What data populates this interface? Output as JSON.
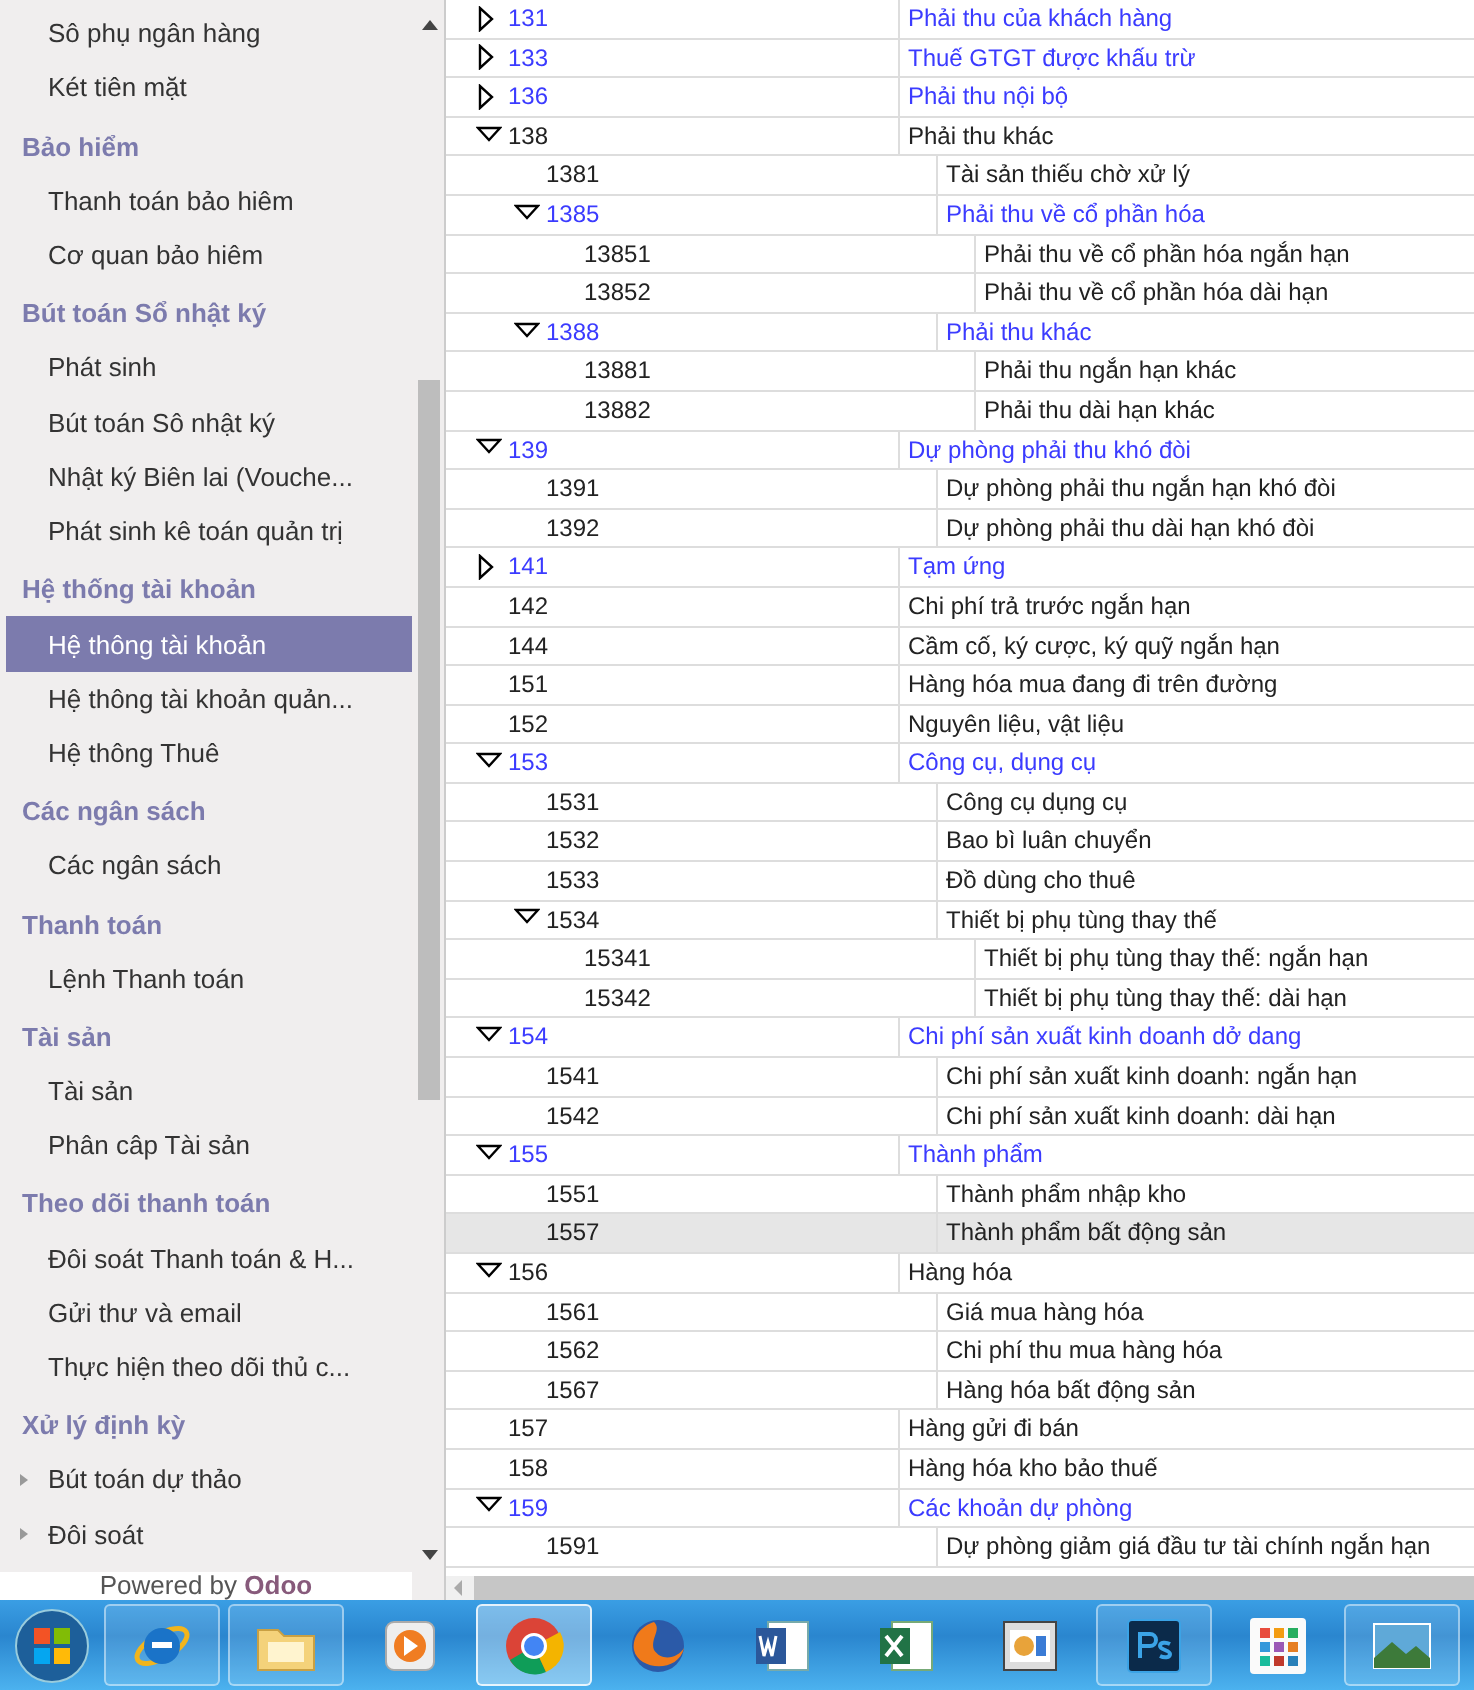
{
  "sidebar": {
    "groups": [
      {
        "items": [
          {
            "label": "Sô phụ ngân hàng",
            "kind": "link",
            "selected": false
          },
          {
            "label": "Két tiên mặt",
            "kind": "link",
            "selected": false
          }
        ]
      },
      {
        "title": "Bảo hiểm",
        "items": [
          {
            "label": "Thanh toán bảo hiêm",
            "kind": "link",
            "selected": false
          },
          {
            "label": "Cơ quan bảo hiêm",
            "kind": "link",
            "selected": false
          }
        ]
      },
      {
        "title": "Bút toán Sổ nhật ký",
        "items": [
          {
            "label": "Phát sinh",
            "kind": "link",
            "selected": false
          },
          {
            "label": "Bút toán Sô nhật ký",
            "kind": "link",
            "selected": false
          },
          {
            "label": "Nhật ký Biên lai (Vouche...",
            "kind": "link",
            "selected": false
          },
          {
            "label": "Phát sinh kê toán quản trị",
            "kind": "link",
            "selected": false
          }
        ]
      },
      {
        "title": "Hệ thống tài khoản",
        "items": [
          {
            "label": "Hệ thông tài khoản",
            "kind": "link",
            "selected": true
          },
          {
            "label": "Hệ thông tài khoản quản...",
            "kind": "link",
            "selected": false
          },
          {
            "label": "Hệ thông Thuê",
            "kind": "link",
            "selected": false
          }
        ]
      },
      {
        "title": "Các ngân sách",
        "items": [
          {
            "label": "Các ngân sách",
            "kind": "link",
            "selected": false
          }
        ]
      },
      {
        "title": "Thanh toán",
        "items": [
          {
            "label": "Lệnh Thanh toán",
            "kind": "link",
            "selected": false
          }
        ]
      },
      {
        "title": "Tài sản",
        "items": [
          {
            "label": "Tài sản",
            "kind": "link",
            "selected": false
          },
          {
            "label": "Phân câp Tài sản",
            "kind": "link",
            "selected": false
          }
        ]
      },
      {
        "title": "Theo dõi thanh toán",
        "items": [
          {
            "label": "Đôi soát Thanh toán & H...",
            "kind": "link",
            "selected": false
          },
          {
            "label": "Gửi thư và email",
            "kind": "link",
            "selected": false
          },
          {
            "label": "Thực hiện theo dõi thủ c...",
            "kind": "link",
            "selected": false
          }
        ]
      },
      {
        "title": "Xử lý định kỳ",
        "items": [
          {
            "label": "Bút toán dự thảo",
            "kind": "folder",
            "selected": false
          },
          {
            "label": "Đôi soát",
            "kind": "folder",
            "selected": false
          }
        ]
      }
    ],
    "footer": {
      "text": "Powered by",
      "brand": "Odoo"
    }
  },
  "tree": {
    "rows": [
      {
        "code": "131",
        "name": "Phải thu của khách hàng",
        "link": true,
        "expanded": false,
        "selected": false
      },
      {
        "code": "133",
        "name": "Thuế GTGT được khấu trừ",
        "link": true,
        "expanded": false,
        "selected": false
      },
      {
        "code": "136",
        "name": "Phải thu nội bộ",
        "link": true,
        "expanded": false,
        "selected": false
      },
      {
        "code": "138",
        "name": "Phải thu khác",
        "link": false,
        "expanded": true,
        "selected": false,
        "children": [
          {
            "code": "1381",
            "name": "Tài sản thiếu chờ xử lý",
            "link": false,
            "selected": false
          },
          {
            "code": "1385",
            "name": "Phải thu về cổ phần hóa",
            "link": true,
            "expanded": true,
            "selected": false,
            "children": [
              {
                "code": "13851",
                "name": "Phải thu về cổ phần hóa ngắn hạn",
                "link": false,
                "selected": false
              },
              {
                "code": "13852",
                "name": "Phải thu về cổ phần hóa dài hạn",
                "link": false,
                "selected": false
              }
            ]
          },
          {
            "code": "1388",
            "name": "Phải thu khác",
            "link": true,
            "expanded": true,
            "selected": false,
            "children": [
              {
                "code": "13881",
                "name": "Phải thu ngắn hạn khác",
                "link": false,
                "selected": false
              },
              {
                "code": "13882",
                "name": "Phải thu dài hạn khác",
                "link": false,
                "selected": false
              }
            ]
          }
        ]
      },
      {
        "code": "139",
        "name": "Dự phòng phải thu khó đòi",
        "link": true,
        "expanded": true,
        "selected": false,
        "children": [
          {
            "code": "1391",
            "name": "Dự phòng phải thu ngắn hạn khó đòi",
            "link": false,
            "selected": false
          },
          {
            "code": "1392",
            "name": "Dự phòng phải thu dài hạn khó đòi",
            "link": false,
            "selected": false
          }
        ]
      },
      {
        "code": "141",
        "name": "Tạm ứng",
        "link": true,
        "expanded": false,
        "selected": false
      },
      {
        "code": "142",
        "name": "Chi phí trả trước ngắn hạn",
        "link": false,
        "selected": false
      },
      {
        "code": "144",
        "name": "Cầm cố, ký cược, ký quỹ ngắn hạn",
        "link": false,
        "selected": false
      },
      {
        "code": "151",
        "name": "Hàng hóa mua đang đi trên đường",
        "link": false,
        "selected": false
      },
      {
        "code": "152",
        "name": "Nguyên liệu, vật liệu",
        "link": false,
        "selected": false
      },
      {
        "code": "153",
        "name": "Công cụ, dụng cụ",
        "link": true,
        "expanded": true,
        "selected": false,
        "children": [
          {
            "code": "1531",
            "name": "Công cụ dụng cụ",
            "link": false,
            "selected": false
          },
          {
            "code": "1532",
            "name": "Bao bì luân chuyển",
            "link": false,
            "selected": false
          },
          {
            "code": "1533",
            "name": "Đồ dùng cho thuê",
            "link": false,
            "selected": false
          },
          {
            "code": "1534",
            "name": "Thiết bị phụ tùng thay thế",
            "link": false,
            "expanded": true,
            "selected": false,
            "children": [
              {
                "code": "15341",
                "name": "Thiết bị phụ tùng thay thế: ngắn hạn",
                "link": false,
                "selected": false
              },
              {
                "code": "15342",
                "name": "Thiết bị phụ tùng thay thế: dài hạn",
                "link": false,
                "selected": false
              }
            ]
          }
        ]
      },
      {
        "code": "154",
        "name": "Chi phí sản xuất kinh doanh dở dang",
        "link": true,
        "expanded": true,
        "selected": false,
        "children": [
          {
            "code": "1541",
            "name": "Chi phí sản xuất kinh doanh: ngắn hạn",
            "link": false,
            "selected": false
          },
          {
            "code": "1542",
            "name": "Chi phí sản xuất kinh doanh: dài hạn",
            "link": false,
            "selected": false
          }
        ]
      },
      {
        "code": "155",
        "name": "Thành phẩm",
        "link": true,
        "expanded": true,
        "selected": false,
        "children": [
          {
            "code": "1551",
            "name": "Thành phẩm nhập kho",
            "link": false,
            "selected": false
          },
          {
            "code": "1557",
            "name": "Thành phẩm bất động sản",
            "link": false,
            "selected": true
          }
        ]
      },
      {
        "code": "156",
        "name": "Hàng hóa",
        "link": false,
        "expanded": true,
        "selected": false,
        "children": [
          {
            "code": "1561",
            "name": "Giá mua hàng hóa",
            "link": false,
            "selected": false
          },
          {
            "code": "1562",
            "name": "Chi phí thu mua hàng hóa",
            "link": false,
            "selected": false
          },
          {
            "code": "1567",
            "name": "Hàng hóa bất động sản",
            "link": false,
            "selected": false
          }
        ]
      },
      {
        "code": "157",
        "name": "Hàng gửi đi bán",
        "link": false,
        "selected": false
      },
      {
        "code": "158",
        "name": "Hàng hóa kho bảo thuế",
        "link": false,
        "selected": false
      },
      {
        "code": "159",
        "name": "Các khoản dự phòng",
        "link": true,
        "expanded": true,
        "selected": false,
        "children": [
          {
            "code": "1591",
            "name": "Dự phòng giảm giá đầu tư tài chính ngắn hạn",
            "link": false,
            "selected": false
          }
        ]
      }
    ]
  },
  "taskbar": {
    "buttons": [
      {
        "running": true,
        "selected": false
      },
      {
        "running": true,
        "selected": false
      },
      {
        "running": false,
        "selected": false
      },
      {
        "running": true,
        "selected": true
      },
      {
        "running": false,
        "selected": false
      },
      {
        "running": false,
        "selected": false
      },
      {
        "running": false,
        "selected": false
      },
      {
        "running": false,
        "selected": false
      },
      {
        "running": true,
        "selected": false
      },
      {
        "running": false,
        "selected": false
      },
      {
        "running": true,
        "selected": false
      }
    ]
  }
}
